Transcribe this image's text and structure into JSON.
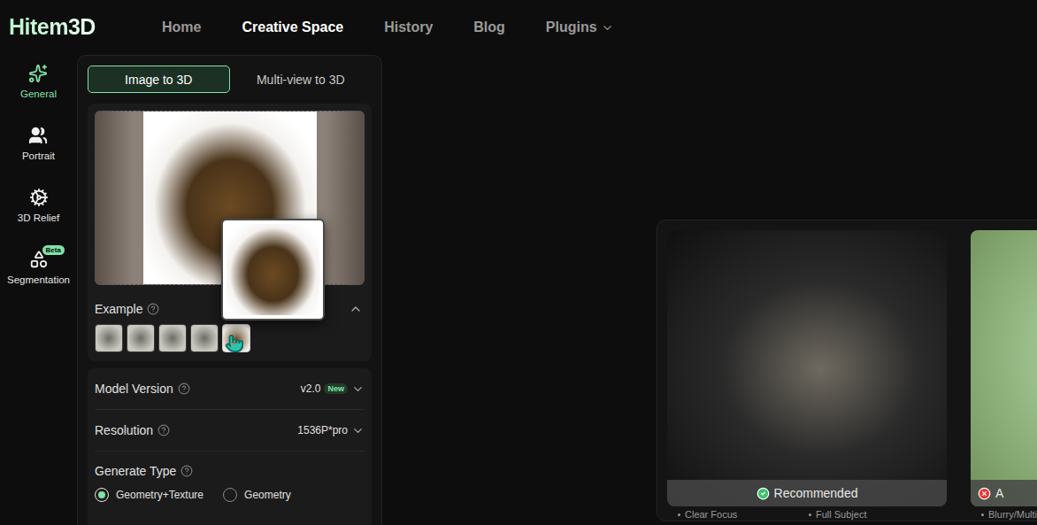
{
  "logo": {
    "text": "Hitem3D"
  },
  "nav": [
    {
      "label": "Home",
      "selected": false,
      "dropdown": false
    },
    {
      "label": "Creative Space",
      "selected": true,
      "dropdown": false
    },
    {
      "label": "History",
      "selected": false,
      "dropdown": false
    },
    {
      "label": "Blog",
      "selected": false,
      "dropdown": false
    },
    {
      "label": "Plugins",
      "selected": false,
      "dropdown": true
    }
  ],
  "sidebar": {
    "items": [
      {
        "label": "General",
        "selected": true,
        "badge": ""
      },
      {
        "label": "Portrait",
        "selected": false,
        "badge": ""
      },
      {
        "label": "3D Relief",
        "selected": false,
        "badge": ""
      },
      {
        "label": "Segmentation",
        "selected": false,
        "badge": "Beta"
      }
    ]
  },
  "tabs": [
    {
      "label": "Image to 3D",
      "selected": true
    },
    {
      "label": "Multi-view to 3D",
      "selected": false
    }
  ],
  "example": {
    "label": "Example",
    "expanded": true,
    "thumbnails": [
      {
        "hovered": false
      },
      {
        "hovered": false
      },
      {
        "hovered": false
      },
      {
        "hovered": false
      },
      {
        "hovered": true
      }
    ]
  },
  "settings": [
    {
      "label": "Model Version",
      "value": "v2.0",
      "badge": "New"
    },
    {
      "label": "Resolution",
      "value": "1536P*pro",
      "badge": ""
    }
  ],
  "generate_type": {
    "label": "Generate Type",
    "options": [
      {
        "label": "Geometry+Texture",
        "selected": true
      },
      {
        "label": "Geometry",
        "selected": false
      }
    ]
  },
  "guide": {
    "cards": [
      {
        "label": "Recommended",
        "kind": "good",
        "tips": [
          "Clear Focus",
          "Full Subject"
        ]
      },
      {
        "label": "A",
        "kind": "bad",
        "tips": [
          "Blurry/Multi"
        ]
      }
    ]
  }
}
